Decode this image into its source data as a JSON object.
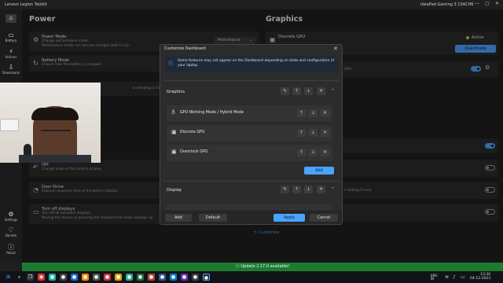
{
  "window": {
    "title": "Lenovo Legion Toolkit",
    "device": "IdeaPad Gaming 3 15ACH6",
    "minimize": "—",
    "maximize": "▢",
    "close": "✕"
  },
  "sidebar": {
    "items": [
      {
        "label": "",
        "icon": "home-icon"
      },
      {
        "label": "Battery",
        "icon": "battery-icon"
      },
      {
        "label": "Actions",
        "icon": "actions-icon"
      },
      {
        "label": "Downloads",
        "icon": "downloads-icon"
      },
      {
        "label": "Settings",
        "icon": "settings-icon"
      },
      {
        "label": "Donate",
        "icon": "donate-icon"
      },
      {
        "label": "About",
        "icon": "about-icon"
      }
    ]
  },
  "power": {
    "heading": "Power",
    "power_mode": {
      "title": "Power Mode",
      "desc1": "Change performance mode.",
      "desc2": "Performance mode can also be changed with Fn+Q.",
      "value": "Performance"
    },
    "battery_mode": {
      "title": "Battery Mode",
      "desc": "Choose how the battery is charged."
    },
    "partial_desc": "or sleeping or hibernated."
  },
  "display": {
    "dpi": {
      "title": "DPI",
      "desc": "Change scale of the built-in display."
    },
    "overdrive": {
      "title": "Over Drive",
      "desc": "Improve response time of the built-in display."
    },
    "turn_off": {
      "title": "Turn off displays",
      "desc1": "Turn off all available displays.",
      "desc2": "Moving the mouse or pressing the keyboard will wake displays up."
    }
  },
  "graphics": {
    "heading": "Graphics",
    "discrete_gpu": {
      "title": "Discrete GPU",
      "status": "Active",
      "deactivate": "Deactivate"
    },
    "partial_right": "GPU",
    "fn_lock_partial": "t holding Fn key."
  },
  "customize": {
    "label": "Customize"
  },
  "dialog": {
    "title": "Customize Dashboard",
    "close": "✕",
    "notice": "Some features may not appear on the Dashboard depending on state and configuration of your laptop.",
    "groups": [
      {
        "name": "Graphics",
        "items": [
          "GPU Working Mode / Hybrid Mode",
          "Discrete GPU",
          "Overclock GPU"
        ],
        "add": "Add"
      },
      {
        "name": "Display",
        "items": []
      }
    ],
    "footer": {
      "add": "Add",
      "default": "Default",
      "apply": "Apply",
      "cancel": "Cancel"
    }
  },
  "update_bar": "Update 2.17.0 available!",
  "taskbar": {
    "lang1": "ENG",
    "lang2": "IN",
    "time": "13:30",
    "date": "04-12-2023"
  },
  "colors": {
    "accent": "#4aa3ff",
    "status_active": "#b7d33b",
    "update_green": "#1f7a31"
  }
}
